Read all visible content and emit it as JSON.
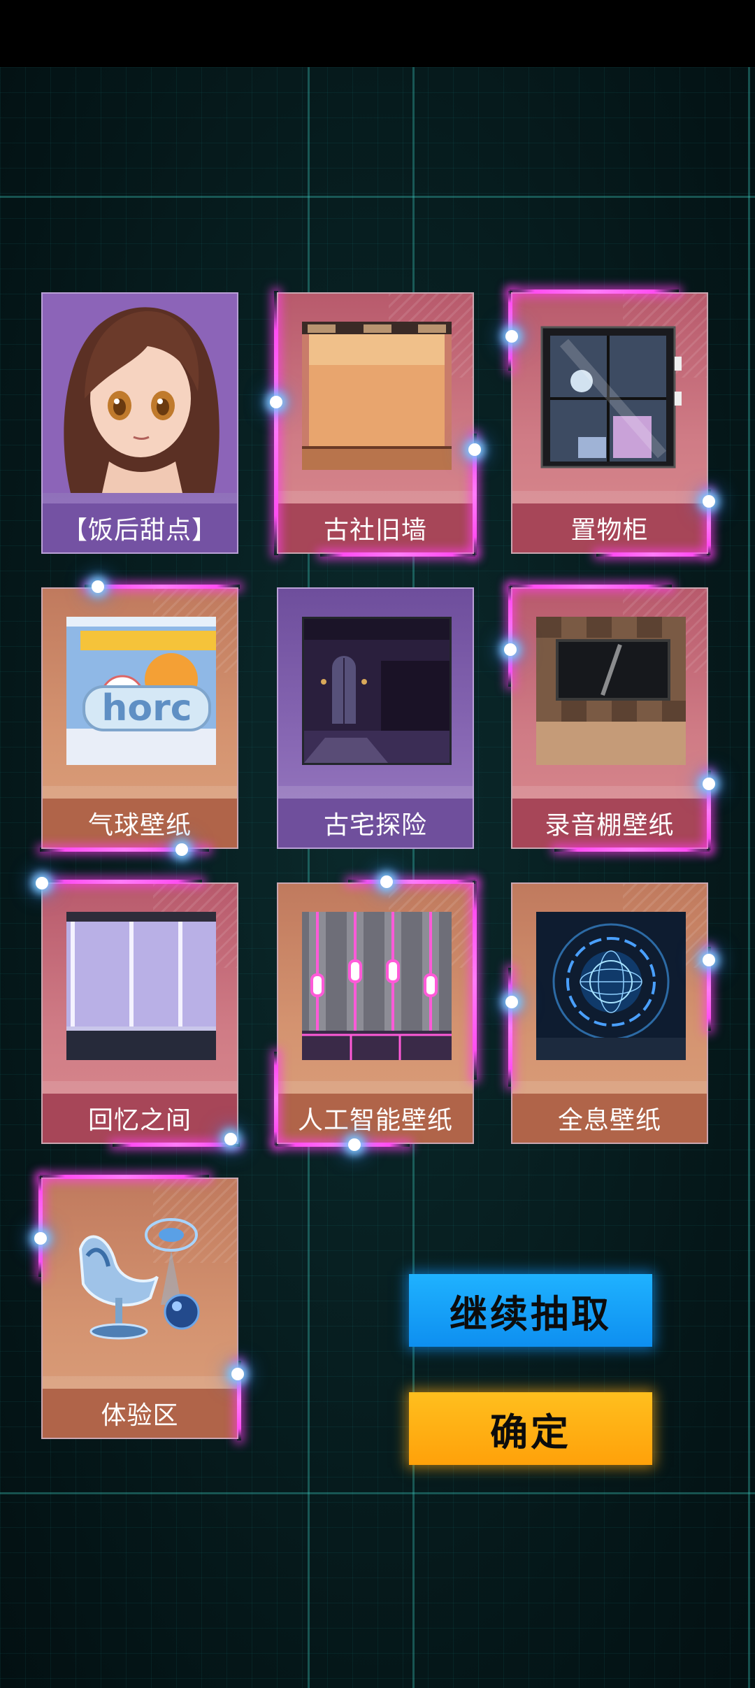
{
  "cards": [
    {
      "label": "【饭后甜点】",
      "theme": "purple",
      "thumb": "anime-girl-portrait"
    },
    {
      "label": "古社旧墙",
      "theme": "pink",
      "thumb": "old-wall-room"
    },
    {
      "label": "置物柜",
      "theme": "pink",
      "thumb": "display-cabinet"
    },
    {
      "label": "气球壁纸",
      "theme": "orange",
      "thumb": "balloon-wallpaper",
      "thumb_text": "horc"
    },
    {
      "label": "古宅探险",
      "theme": "purple",
      "thumb": "dark-mansion-room"
    },
    {
      "label": "录音棚壁纸",
      "theme": "pink",
      "thumb": "recording-studio-wall"
    },
    {
      "label": "回忆之间",
      "theme": "pink",
      "thumb": "memory-room"
    },
    {
      "label": "人工智能壁纸",
      "theme": "orange",
      "thumb": "ai-neon-wall"
    },
    {
      "label": "全息壁纸",
      "theme": "orange",
      "thumb": "hologram-globe"
    },
    {
      "label": "体验区",
      "theme": "orange",
      "thumb": "hologram-chair"
    }
  ],
  "buttons": {
    "continue_label": "继续抽取",
    "confirm_label": "确定"
  },
  "colors": {
    "continue_button": "#1aa6ff",
    "confirm_button": "#ffb015",
    "glow": "#ff4ef2"
  }
}
